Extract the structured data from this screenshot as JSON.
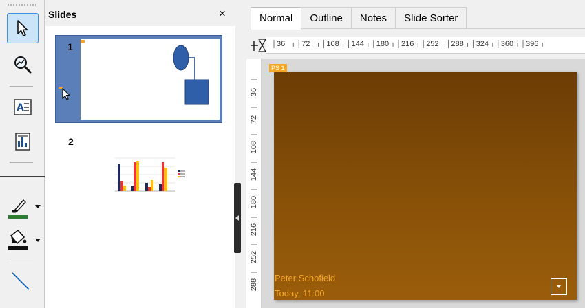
{
  "slides_pane": {
    "title": "Slides",
    "close_icon": "×",
    "slides": [
      {
        "number": "1"
      },
      {
        "number": "2"
      }
    ]
  },
  "tabs": [
    {
      "label": "Normal",
      "active": true
    },
    {
      "label": "Outline",
      "active": false
    },
    {
      "label": "Notes",
      "active": false
    },
    {
      "label": "Slide Sorter",
      "active": false
    }
  ],
  "ruler": {
    "horizontal": [
      "36",
      "72",
      "108",
      "144",
      "180",
      "216",
      "252",
      "288",
      "324",
      "360",
      "396"
    ],
    "vertical": [
      "36",
      "72",
      "108",
      "144",
      "180",
      "216",
      "252",
      "288"
    ]
  },
  "slide": {
    "tag": "PS 1",
    "presenter": "Peter Schofield",
    "datetime": "Today, 11:00"
  },
  "icons": {
    "select": "arrow-cursor-icon",
    "zoom": "zoom-icon",
    "text": "text-box-icon",
    "insert": "insert-image-icon",
    "line_color": "line-color-icon",
    "fill_color": "fill-color-icon",
    "line": "line-tool-icon"
  },
  "colors": {
    "accent": "#3a8ee6",
    "slide_bg": "#7a4407",
    "tag": "#f5a623",
    "footer_text": "#f5a623"
  }
}
